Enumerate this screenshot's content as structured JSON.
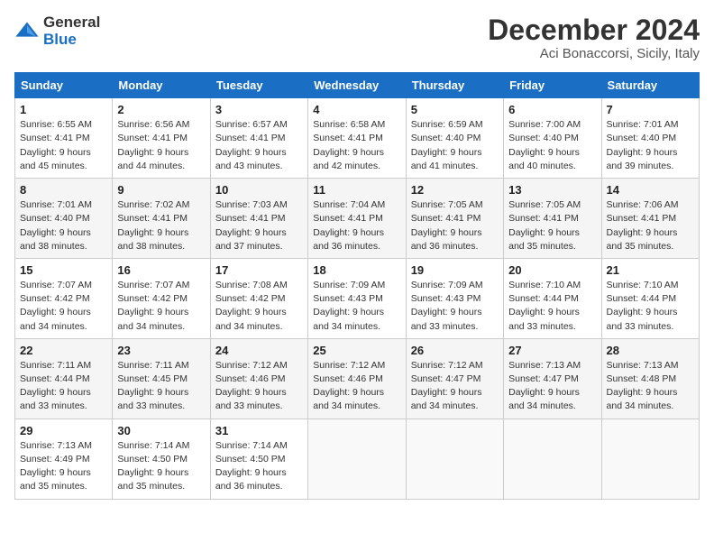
{
  "logo": {
    "general": "General",
    "blue": "Blue"
  },
  "title": "December 2024",
  "subtitle": "Aci Bonaccorsi, Sicily, Italy",
  "days_of_week": [
    "Sunday",
    "Monday",
    "Tuesday",
    "Wednesday",
    "Thursday",
    "Friday",
    "Saturday"
  ],
  "weeks": [
    [
      {
        "day": "1",
        "sunrise": "6:55 AM",
        "sunset": "4:41 PM",
        "daylight": "9 hours and 45 minutes."
      },
      {
        "day": "2",
        "sunrise": "6:56 AM",
        "sunset": "4:41 PM",
        "daylight": "9 hours and 44 minutes."
      },
      {
        "day": "3",
        "sunrise": "6:57 AM",
        "sunset": "4:41 PM",
        "daylight": "9 hours and 43 minutes."
      },
      {
        "day": "4",
        "sunrise": "6:58 AM",
        "sunset": "4:41 PM",
        "daylight": "9 hours and 42 minutes."
      },
      {
        "day": "5",
        "sunrise": "6:59 AM",
        "sunset": "4:40 PM",
        "daylight": "9 hours and 41 minutes."
      },
      {
        "day": "6",
        "sunrise": "7:00 AM",
        "sunset": "4:40 PM",
        "daylight": "9 hours and 40 minutes."
      },
      {
        "day": "7",
        "sunrise": "7:01 AM",
        "sunset": "4:40 PM",
        "daylight": "9 hours and 39 minutes."
      }
    ],
    [
      {
        "day": "8",
        "sunrise": "7:01 AM",
        "sunset": "4:40 PM",
        "daylight": "9 hours and 38 minutes."
      },
      {
        "day": "9",
        "sunrise": "7:02 AM",
        "sunset": "4:41 PM",
        "daylight": "9 hours and 38 minutes."
      },
      {
        "day": "10",
        "sunrise": "7:03 AM",
        "sunset": "4:41 PM",
        "daylight": "9 hours and 37 minutes."
      },
      {
        "day": "11",
        "sunrise": "7:04 AM",
        "sunset": "4:41 PM",
        "daylight": "9 hours and 36 minutes."
      },
      {
        "day": "12",
        "sunrise": "7:05 AM",
        "sunset": "4:41 PM",
        "daylight": "9 hours and 36 minutes."
      },
      {
        "day": "13",
        "sunrise": "7:05 AM",
        "sunset": "4:41 PM",
        "daylight": "9 hours and 35 minutes."
      },
      {
        "day": "14",
        "sunrise": "7:06 AM",
        "sunset": "4:41 PM",
        "daylight": "9 hours and 35 minutes."
      }
    ],
    [
      {
        "day": "15",
        "sunrise": "7:07 AM",
        "sunset": "4:42 PM",
        "daylight": "9 hours and 34 minutes."
      },
      {
        "day": "16",
        "sunrise": "7:07 AM",
        "sunset": "4:42 PM",
        "daylight": "9 hours and 34 minutes."
      },
      {
        "day": "17",
        "sunrise": "7:08 AM",
        "sunset": "4:42 PM",
        "daylight": "9 hours and 34 minutes."
      },
      {
        "day": "18",
        "sunrise": "7:09 AM",
        "sunset": "4:43 PM",
        "daylight": "9 hours and 34 minutes."
      },
      {
        "day": "19",
        "sunrise": "7:09 AM",
        "sunset": "4:43 PM",
        "daylight": "9 hours and 33 minutes."
      },
      {
        "day": "20",
        "sunrise": "7:10 AM",
        "sunset": "4:44 PM",
        "daylight": "9 hours and 33 minutes."
      },
      {
        "day": "21",
        "sunrise": "7:10 AM",
        "sunset": "4:44 PM",
        "daylight": "9 hours and 33 minutes."
      }
    ],
    [
      {
        "day": "22",
        "sunrise": "7:11 AM",
        "sunset": "4:44 PM",
        "daylight": "9 hours and 33 minutes."
      },
      {
        "day": "23",
        "sunrise": "7:11 AM",
        "sunset": "4:45 PM",
        "daylight": "9 hours and 33 minutes."
      },
      {
        "day": "24",
        "sunrise": "7:12 AM",
        "sunset": "4:46 PM",
        "daylight": "9 hours and 33 minutes."
      },
      {
        "day": "25",
        "sunrise": "7:12 AM",
        "sunset": "4:46 PM",
        "daylight": "9 hours and 34 minutes."
      },
      {
        "day": "26",
        "sunrise": "7:12 AM",
        "sunset": "4:47 PM",
        "daylight": "9 hours and 34 minutes."
      },
      {
        "day": "27",
        "sunrise": "7:13 AM",
        "sunset": "4:47 PM",
        "daylight": "9 hours and 34 minutes."
      },
      {
        "day": "28",
        "sunrise": "7:13 AM",
        "sunset": "4:48 PM",
        "daylight": "9 hours and 34 minutes."
      }
    ],
    [
      {
        "day": "29",
        "sunrise": "7:13 AM",
        "sunset": "4:49 PM",
        "daylight": "9 hours and 35 minutes."
      },
      {
        "day": "30",
        "sunrise": "7:14 AM",
        "sunset": "4:50 PM",
        "daylight": "9 hours and 35 minutes."
      },
      {
        "day": "31",
        "sunrise": "7:14 AM",
        "sunset": "4:50 PM",
        "daylight": "9 hours and 36 minutes."
      },
      null,
      null,
      null,
      null
    ]
  ]
}
